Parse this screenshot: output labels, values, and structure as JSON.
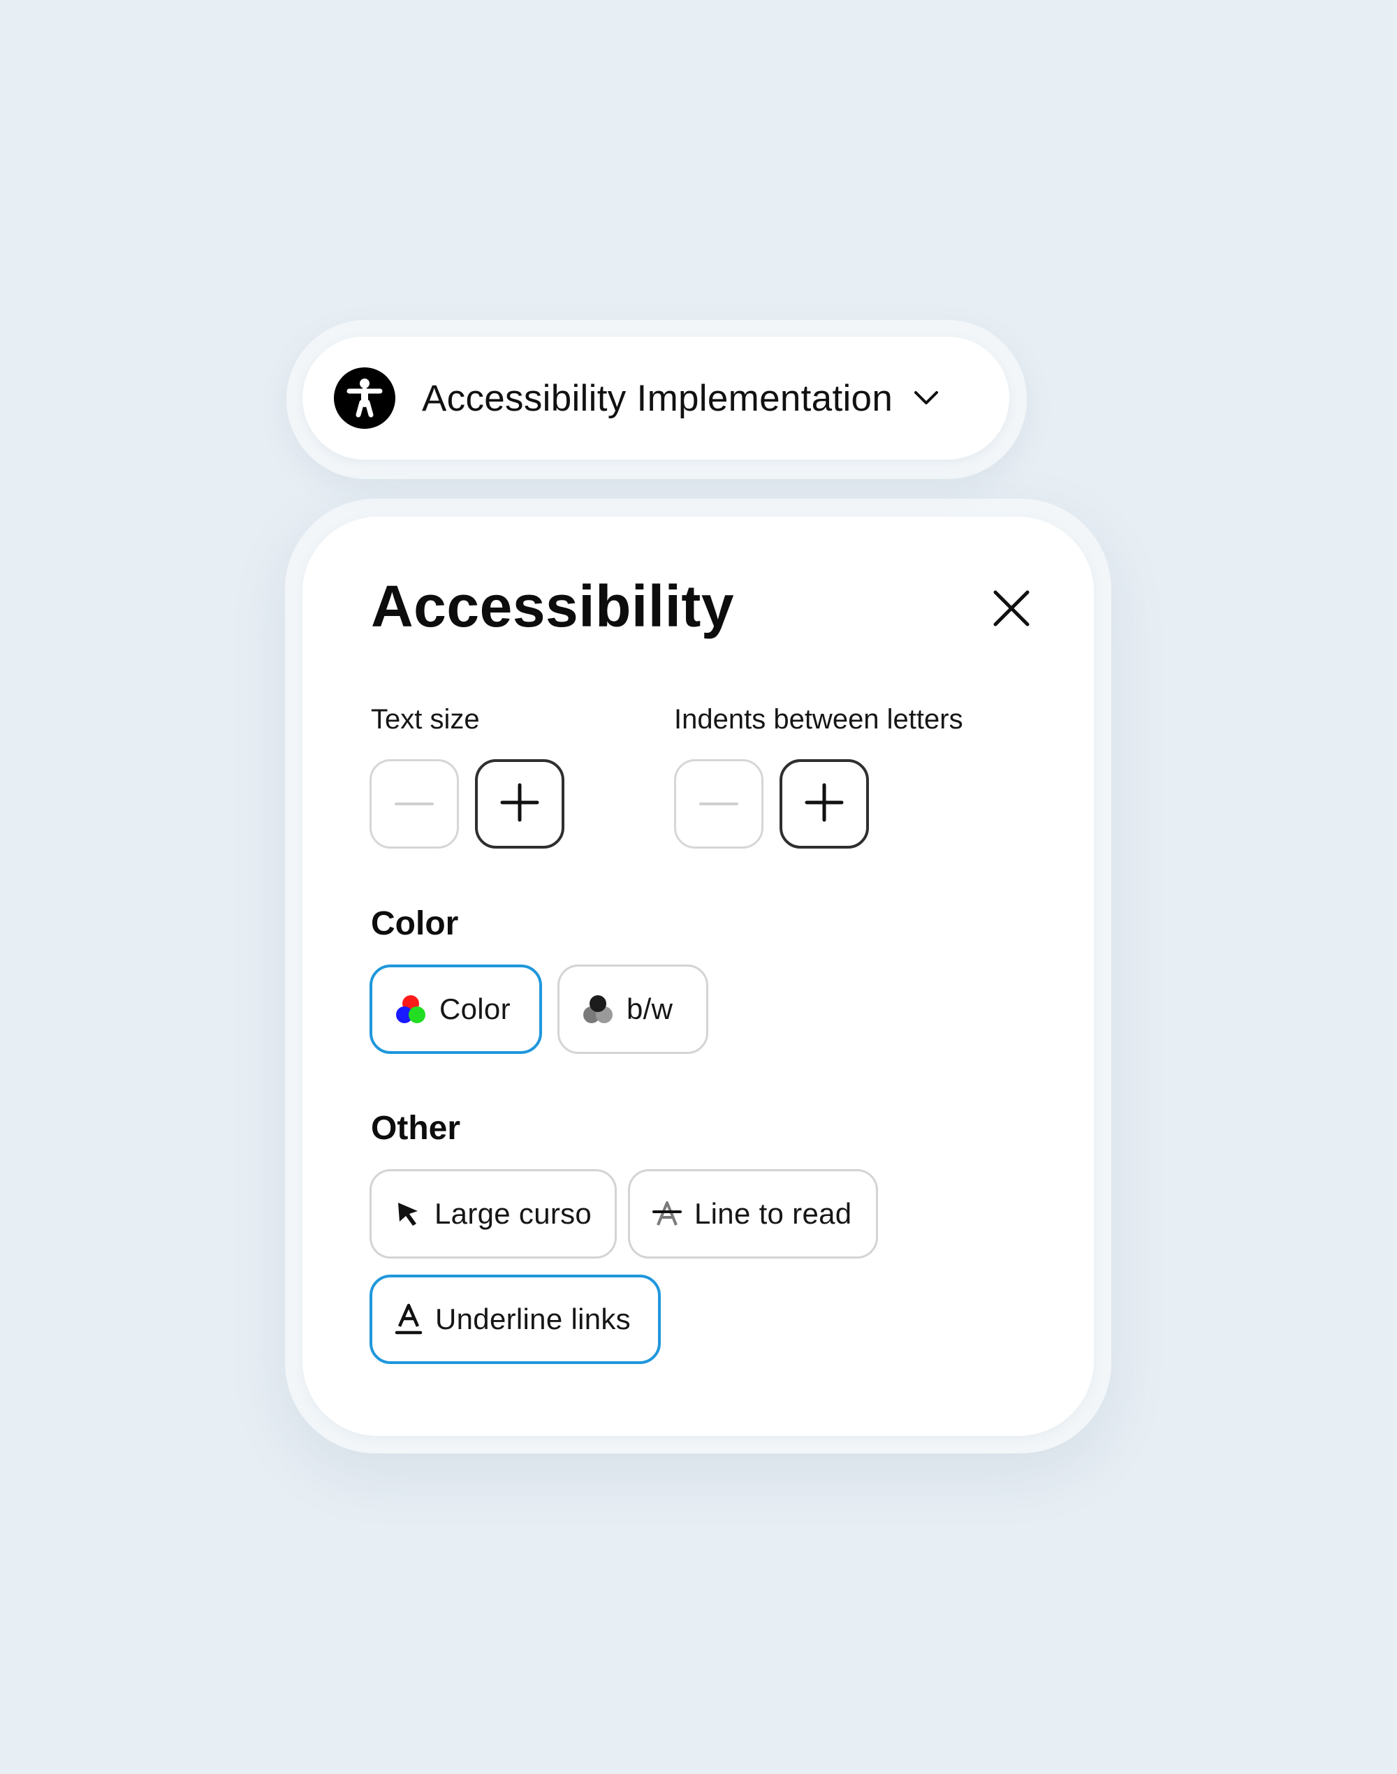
{
  "widget": {
    "title": "Accessibility Implementation",
    "icon": "accessibility-person-icon",
    "chevron_icon": "chevron-down-icon"
  },
  "panel": {
    "title": "Accessibility",
    "close_icon": "close-icon",
    "text_size": {
      "label": "Text size",
      "decrease_icon": "minus-icon",
      "increase_icon": "plus-icon",
      "decrease_enabled": false,
      "increase_enabled": true
    },
    "letter_spacing": {
      "label": "Indents between letters",
      "decrease_icon": "minus-icon",
      "increase_icon": "plus-icon",
      "decrease_enabled": false,
      "increase_enabled": true
    },
    "color_section": {
      "title": "Color",
      "options": [
        {
          "label": "Color",
          "icon": "rgb-circles-icon",
          "selected": true
        },
        {
          "label": "b/w",
          "icon": "grayscale-circles-icon",
          "selected": false
        }
      ]
    },
    "other_section": {
      "title": "Other",
      "options": [
        {
          "label": "Large curso",
          "icon": "cursor-arrow-icon",
          "selected": false
        },
        {
          "label": "Line to read",
          "icon": "strikethrough-a-icon",
          "selected": false
        },
        {
          "label": "Underline links",
          "icon": "underline-a-icon",
          "selected": true
        }
      ]
    }
  },
  "colors": {
    "background": "#e7eef4",
    "surface": "#ffffff",
    "accent": "#1f97dc",
    "text": "#111111",
    "border": "#d4d4d4"
  }
}
